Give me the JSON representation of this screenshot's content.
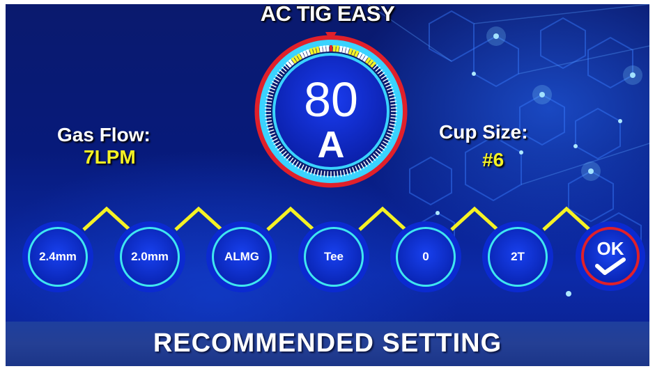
{
  "header": {
    "mode_title": "AC TIG EASY"
  },
  "gauge": {
    "current_value": "80",
    "current_unit": "A"
  },
  "gas_flow": {
    "label": "Gas Flow:",
    "value": "7LPM"
  },
  "cup_size": {
    "label": "Cup Size:",
    "value": "#6"
  },
  "options": [
    {
      "label": "2.4mm"
    },
    {
      "label": "2.0mm"
    },
    {
      "label": "ALMG"
    },
    {
      "label": "Tee"
    },
    {
      "label": "0"
    },
    {
      "label": "2T"
    }
  ],
  "ok_button": {
    "label": "OK",
    "icon": "checkmark-icon"
  },
  "footer": {
    "title": "RECOMMENDED SETTING"
  },
  "colors": {
    "accent_yellow": "#f5f224",
    "ring_cyan": "#3fe6f0",
    "ring_red": "#e0202a",
    "button_blue": "#0b2ad0"
  }
}
